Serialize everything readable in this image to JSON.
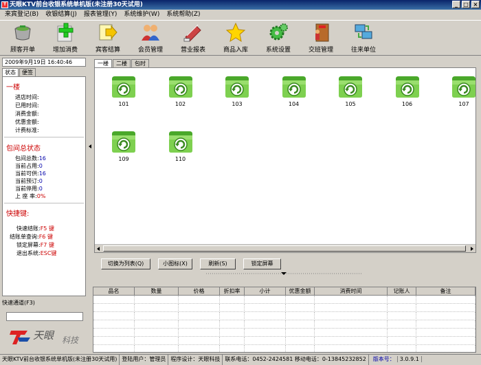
{
  "window": {
    "title": "天眼KTV前台收银系统单机版(未注册30天试用)",
    "minimize": "_",
    "maximize": "□",
    "close": "×"
  },
  "menu": [
    "来宾登记(B)",
    "收银结算(J)",
    "报表管理(Y)",
    "系统维护(W)",
    "系统帮助(Z)"
  ],
  "toolbar": [
    {
      "label": "顾客开单",
      "icon": "cup-icon"
    },
    {
      "label": "增加消费",
      "icon": "plus-icon"
    },
    {
      "label": "宾客结算",
      "icon": "arrow-right-icon"
    },
    {
      "label": "会员管理",
      "icon": "users-icon"
    },
    {
      "label": "营业报表",
      "icon": "report-icon"
    },
    {
      "label": "商品入库",
      "icon": "star-icon"
    },
    {
      "label": "系统设置",
      "icon": "gear-icon"
    },
    {
      "label": "交班管理",
      "icon": "exit-door-icon"
    },
    {
      "label": "往来单位",
      "icon": "computer-network-icon"
    }
  ],
  "left": {
    "datetime": "2009年9月19日  16:40:46",
    "tabs": [
      "状态",
      "便签"
    ],
    "room_section": "一楼",
    "room_fields": [
      "进店时间:",
      "已用时间:",
      "消费金额:",
      "优惠金额:",
      "计费标准:"
    ],
    "summary_title": "包间总状态",
    "summary": [
      {
        "label": "包间总数:",
        "value": "16"
      },
      {
        "label": "当前占用:",
        "value": "0"
      },
      {
        "label": "当前可供:",
        "value": "16"
      },
      {
        "label": "当前预订:",
        "value": "0"
      },
      {
        "label": "当前停用:",
        "value": "0"
      },
      {
        "label": "上 座 率:",
        "value": "0%"
      }
    ],
    "shortcut_title": "快捷键:",
    "shortcuts": [
      {
        "label": "快速结账:",
        "key": "F5 键"
      },
      {
        "label": "结账单查询:",
        "key": "F6 键"
      },
      {
        "label": "锁定屏幕:",
        "key": "F7 键"
      },
      {
        "label": "退出系统:",
        "key": "ESC键"
      }
    ],
    "quick_label": "快速通道(F3)",
    "quick_input": "",
    "logo_text": "天眼",
    "logo_sub": "科技"
  },
  "rooms": {
    "tabs": [
      "一楼",
      "二楼",
      "包时"
    ],
    "items": [
      "101",
      "102",
      "103",
      "104",
      "105",
      "106",
      "107",
      "109",
      "110"
    ]
  },
  "buttons": [
    "切换为列表(Q)",
    "小图标(X)",
    "刷新(S)",
    "锁定屏幕"
  ],
  "table": {
    "headers": [
      "品名",
      "数量",
      "价格",
      "折扣率",
      "小计",
      "优惠金额",
      "消费时间",
      "记账人",
      "备注"
    ]
  },
  "status": {
    "app": "天眼KTV前台收银系统单机版(未注册30天试用)",
    "user": "登陆用户：管理员",
    "design": "程序设计：天眼科技",
    "contact": "联系电话：0452-2424581 移动电话：0-13845232852",
    "version_label": "版本号：",
    "version": "3.0.9.1"
  },
  "colors": {
    "room_icon": "#6cc63c",
    "section_title": "#cc0000",
    "value": "#0000aa",
    "titlebar": "#0a246a"
  }
}
